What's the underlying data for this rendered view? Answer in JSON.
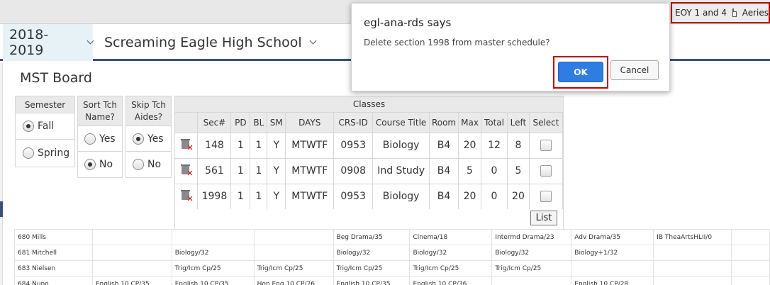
{
  "topbar": {
    "scenario": "EOY 1 and 4",
    "app_name": "Aeries"
  },
  "header": {
    "year": "2018-2019",
    "school": "Screaming Eagle High School"
  },
  "board": {
    "title": "MST Board"
  },
  "semester": {
    "heading": "Semester",
    "options": [
      "Fall",
      "Spring"
    ],
    "selected": "Fall"
  },
  "sort_teacher": {
    "heading": "Sort Tch Name?",
    "options": [
      "Yes",
      "No"
    ],
    "selected": "No"
  },
  "skip_aides": {
    "heading": "Skip Tch Aides?",
    "options": [
      "Yes",
      "No"
    ],
    "selected": "Yes"
  },
  "classes": {
    "heading": "Classes",
    "columns": [
      "Sec#",
      "PD",
      "BL",
      "SM",
      "DAYS",
      "CRS-ID",
      "Course Title",
      "Room",
      "Max",
      "Total",
      "Left",
      "Select"
    ],
    "rows": [
      [
        "148",
        "1",
        "1",
        "Y",
        "MTWTF",
        "0953",
        "Biology",
        "B4",
        "20",
        "12",
        "8"
      ],
      [
        "561",
        "1",
        "1",
        "Y",
        "MTWTF",
        "0908",
        "Ind Study",
        "B4",
        "5",
        "0",
        "5"
      ],
      [
        "1998",
        "1",
        "1",
        "Y",
        "MTWTF",
        "0953",
        "Biology",
        "B4",
        "20",
        "0",
        "20"
      ]
    ],
    "list_label": "List"
  },
  "grid": {
    "rows": [
      [
        "680 Mills",
        "",
        "",
        "",
        "Beg Drama/35",
        "Cinema/18",
        "Intermd Drama/23",
        "Adv Drama/35",
        "IB TheaArtsHLII/0",
        ""
      ],
      [
        "681 Mitchell",
        "",
        "Biology/32",
        "",
        "Biology/32",
        "Biology/32",
        "Biology/32",
        "Biology+1/32",
        "",
        ""
      ],
      [
        "683 Nielsen",
        "",
        "Trig/Icm Cp/25",
        "Trig/Icm Cp/25",
        "Trig/Icm Cp/25",
        "Trig/Icm Cp/25",
        "Trig/Icm Cp/25",
        "",
        "",
        ""
      ],
      [
        "684 Nuno",
        "English 10 CP/35",
        "English 10 CP/35",
        "Hon Eng 10 CP/26",
        "English 10 CP/35",
        "English 10 CP/36",
        "",
        "English 10 CP/28",
        "",
        ""
      ]
    ]
  },
  "dialog": {
    "title": "egl-ana-rds says",
    "message": "Delete section 1998 from master schedule?",
    "ok_label": "OK",
    "cancel_label": "Cancel"
  },
  "colors": {
    "accent": "#2f7de1",
    "header_rule": "#3a4f7a",
    "highlight": "#c00000",
    "year_bg": "#e6f2f6"
  }
}
